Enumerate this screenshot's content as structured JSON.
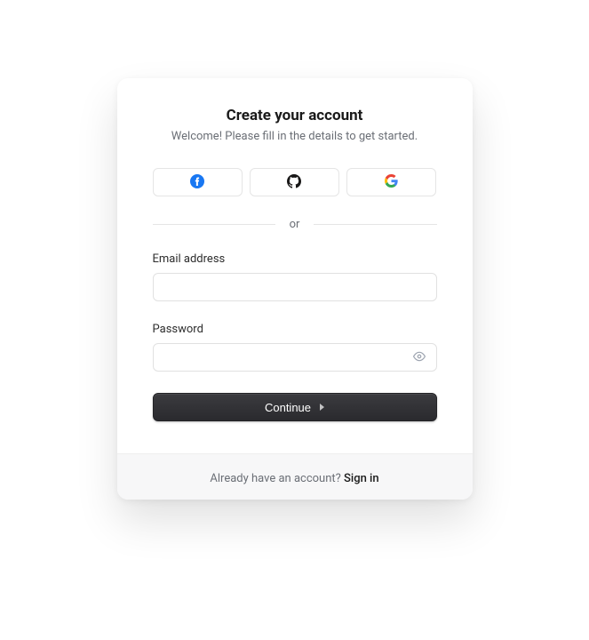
{
  "header": {
    "title": "Create your account",
    "subtitle": "Welcome! Please fill in the details to get started."
  },
  "oauth": {
    "facebook_name": "facebook",
    "github_name": "github",
    "google_name": "google"
  },
  "divider": {
    "text": "or"
  },
  "fields": {
    "email": {
      "label": "Email address",
      "value": ""
    },
    "password": {
      "label": "Password",
      "value": ""
    }
  },
  "actions": {
    "continue_label": "Continue"
  },
  "footer": {
    "prompt": "Already have an account? ",
    "link_label": "Sign in"
  }
}
